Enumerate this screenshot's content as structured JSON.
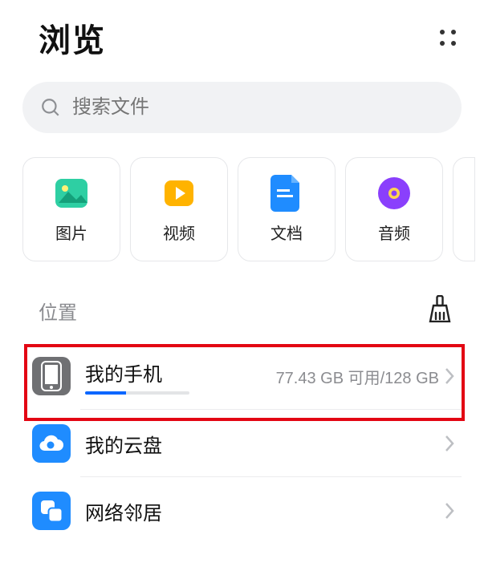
{
  "header": {
    "title": "浏览"
  },
  "search": {
    "placeholder": "搜索文件"
  },
  "categories": [
    {
      "key": "images",
      "label": "图片"
    },
    {
      "key": "videos",
      "label": "视频"
    },
    {
      "key": "docs",
      "label": "文档"
    },
    {
      "key": "audio",
      "label": "音频"
    }
  ],
  "section": {
    "title": "位置"
  },
  "storage": {
    "my_phone": {
      "label": "我的手机",
      "detail": "77.43 GB 可用/128 GB",
      "used_fraction": 0.395
    },
    "my_cloud": {
      "label": "我的云盘"
    },
    "network": {
      "label": "网络邻居"
    }
  }
}
